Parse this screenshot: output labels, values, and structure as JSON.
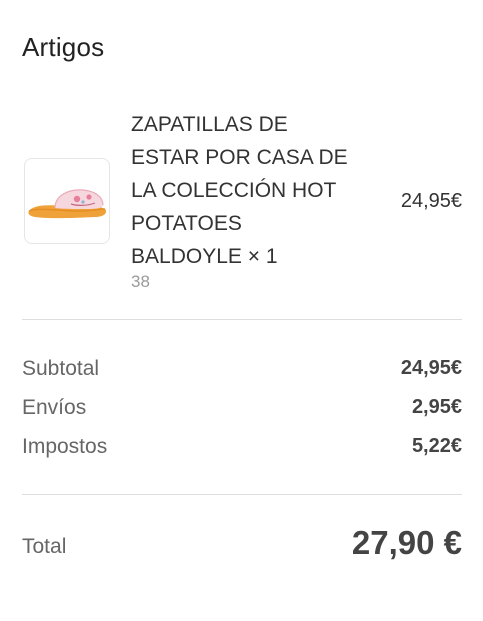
{
  "section_title": "Artigos",
  "item": {
    "name_lines": [
      "ZAPATILLAS DE",
      "ESTAR POR CASA DE",
      "LA COLECCIÓN HOT",
      "POTATOES",
      "BALDOYLE × 1"
    ],
    "variant": "38",
    "price": "24,95€",
    "image_icon": "slipper-product-image"
  },
  "summary": {
    "subtotal_label": "Subtotal",
    "subtotal_value": "24,95€",
    "shipping_label": "Envíos",
    "shipping_value": "2,95€",
    "taxes_label": "Impostos",
    "taxes_value": "5,22€"
  },
  "total": {
    "label": "Total",
    "value": "27,90 €"
  },
  "colors": {
    "text_primary": "#333333",
    "text_secondary": "#666666",
    "text_muted": "#9a9a9a",
    "divider": "#dedede",
    "slipper_orange": "#f0a23a",
    "slipper_pink": "#f3c9d2"
  }
}
